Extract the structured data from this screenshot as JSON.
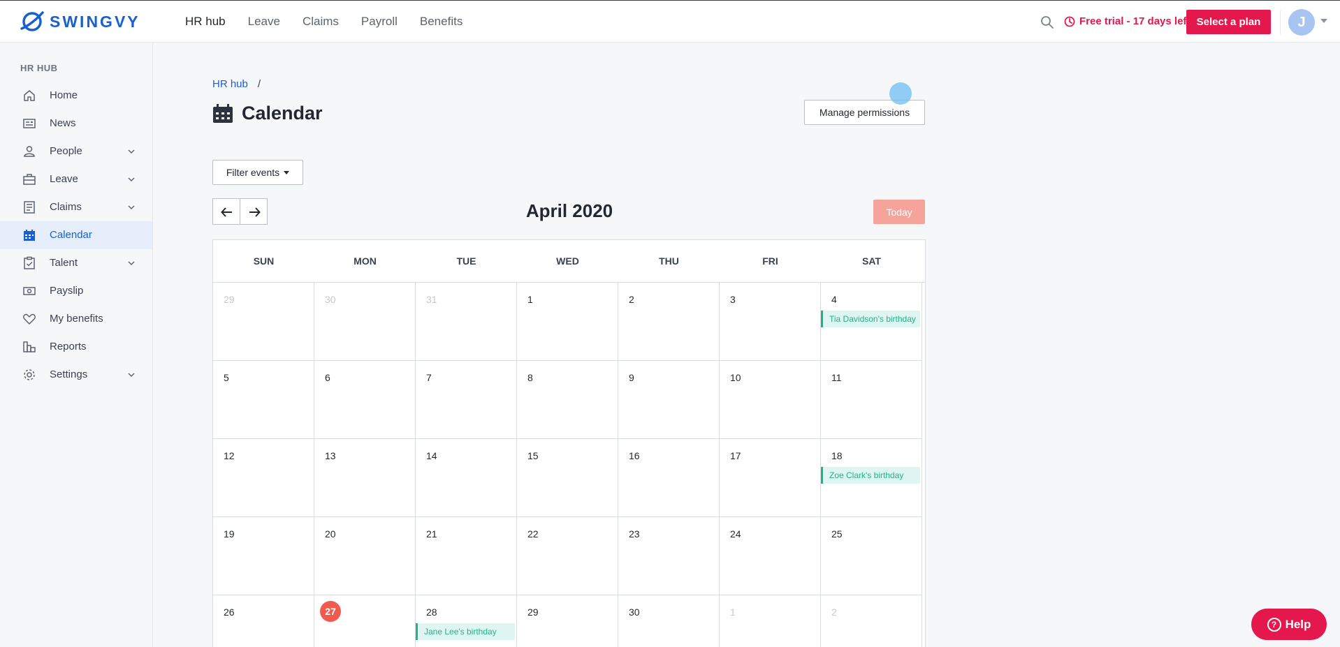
{
  "brand": {
    "name": "SWINGVY",
    "color": "#1a5fd1",
    "accent": "#e5184d"
  },
  "topnav": {
    "items": [
      "HR hub",
      "Leave",
      "Claims",
      "Payroll",
      "Benefits"
    ],
    "active": "HR hub"
  },
  "header": {
    "trial_text": "Free trial - 17 days left",
    "select_plan": "Select a plan",
    "avatar_initial": "J"
  },
  "sidebar": {
    "heading": "HR HUB",
    "items": [
      {
        "label": "Home",
        "icon": "home-icon",
        "expandable": false
      },
      {
        "label": "News",
        "icon": "news-icon",
        "expandable": false
      },
      {
        "label": "People",
        "icon": "person-icon",
        "expandable": true
      },
      {
        "label": "Leave",
        "icon": "briefcase-icon",
        "expandable": true
      },
      {
        "label": "Claims",
        "icon": "receipt-icon",
        "expandable": true
      },
      {
        "label": "Calendar",
        "icon": "calendar-icon",
        "expandable": false,
        "active": true
      },
      {
        "label": "Talent",
        "icon": "clipboard-icon",
        "expandable": true
      },
      {
        "label": "Payslip",
        "icon": "money-icon",
        "expandable": false
      },
      {
        "label": "My benefits",
        "icon": "heart-icon",
        "expandable": false
      },
      {
        "label": "Reports",
        "icon": "bar-chart-icon",
        "expandable": false
      },
      {
        "label": "Settings",
        "icon": "gear-icon",
        "expandable": true
      }
    ]
  },
  "breadcrumb": {
    "root": "HR hub",
    "separator": "/"
  },
  "page": {
    "title": "Calendar",
    "manage_permissions": "Manage permissions",
    "filter_events": "Filter events",
    "today": "Today"
  },
  "calendar": {
    "month": "April 2020",
    "weekdays": [
      "SUN",
      "MON",
      "TUE",
      "WED",
      "THU",
      "FRI",
      "SAT"
    ],
    "weeks": [
      [
        {
          "d": "29",
          "muted": true
        },
        {
          "d": "30",
          "muted": true
        },
        {
          "d": "31",
          "muted": true
        },
        {
          "d": "1"
        },
        {
          "d": "2"
        },
        {
          "d": "3"
        },
        {
          "d": "4",
          "event": "Tia Davidson's birthday"
        }
      ],
      [
        {
          "d": "5"
        },
        {
          "d": "6"
        },
        {
          "d": "7"
        },
        {
          "d": "8"
        },
        {
          "d": "9"
        },
        {
          "d": "10"
        },
        {
          "d": "11"
        }
      ],
      [
        {
          "d": "12"
        },
        {
          "d": "13"
        },
        {
          "d": "14"
        },
        {
          "d": "15"
        },
        {
          "d": "16"
        },
        {
          "d": "17"
        },
        {
          "d": "18",
          "event": "Zoe Clark's birthday"
        }
      ],
      [
        {
          "d": "19"
        },
        {
          "d": "20"
        },
        {
          "d": "21"
        },
        {
          "d": "22"
        },
        {
          "d": "23"
        },
        {
          "d": "24"
        },
        {
          "d": "25"
        }
      ],
      [
        {
          "d": "26"
        },
        {
          "d": "27",
          "today": true
        },
        {
          "d": "28",
          "event": "Jane Lee's birthday"
        },
        {
          "d": "29"
        },
        {
          "d": "30"
        },
        {
          "d": "1",
          "muted": true
        },
        {
          "d": "2",
          "muted": true
        }
      ]
    ]
  },
  "help": {
    "label": "Help"
  }
}
